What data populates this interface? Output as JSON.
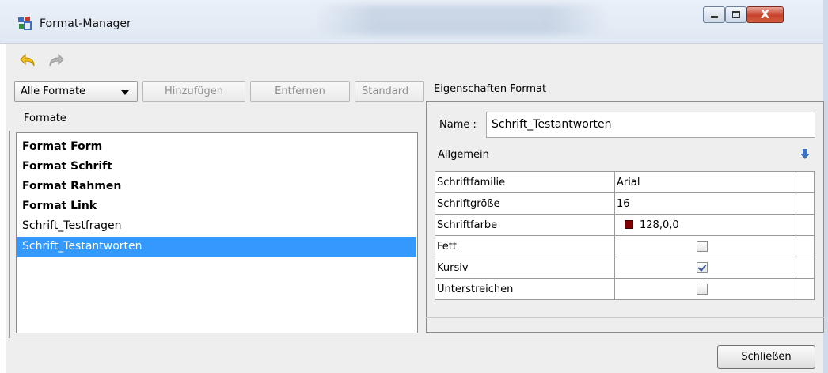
{
  "window": {
    "title": "Format-Manager",
    "close_glyph": "X"
  },
  "toolbar": {
    "undo_icon": "undo-arrow-icon",
    "redo_icon": "redo-arrow-icon"
  },
  "buttons": {
    "filter_selected": "Alle Formate",
    "add": "Hinzufügen",
    "remove": "Entfernen",
    "default": "Standard"
  },
  "formats": {
    "header": "Formate",
    "items": [
      {
        "label": "Format Form",
        "bold": true
      },
      {
        "label": "Format Schrift",
        "bold": true
      },
      {
        "label": "Format Rahmen",
        "bold": true
      },
      {
        "label": "Format Link",
        "bold": true
      },
      {
        "label": "Schrift_Testfragen",
        "bold": false
      },
      {
        "label": "Schrift_Testantworten",
        "bold": false,
        "selected": true
      }
    ]
  },
  "properties": {
    "title": "Eigenschaften Format",
    "name_label": "Name :",
    "name_value": "Schrift_Testantworten",
    "section": "Allgemein",
    "rows": [
      {
        "key": "Schriftfamilie",
        "value": "Arial"
      },
      {
        "key": "Schriftgröße",
        "value": "16"
      },
      {
        "key": "Schriftfarbe",
        "value": "128,0,0",
        "color": "#800000"
      },
      {
        "key": "Fett",
        "checked": false
      },
      {
        "key": "Kursiv",
        "checked": true
      },
      {
        "key": "Unterstreichen",
        "checked": false
      }
    ]
  },
  "footer": {
    "close": "Schließen"
  },
  "colors": {
    "selection": "#3399ff",
    "titlebar": "#dfe8f3",
    "close_button": "#c7412a"
  }
}
